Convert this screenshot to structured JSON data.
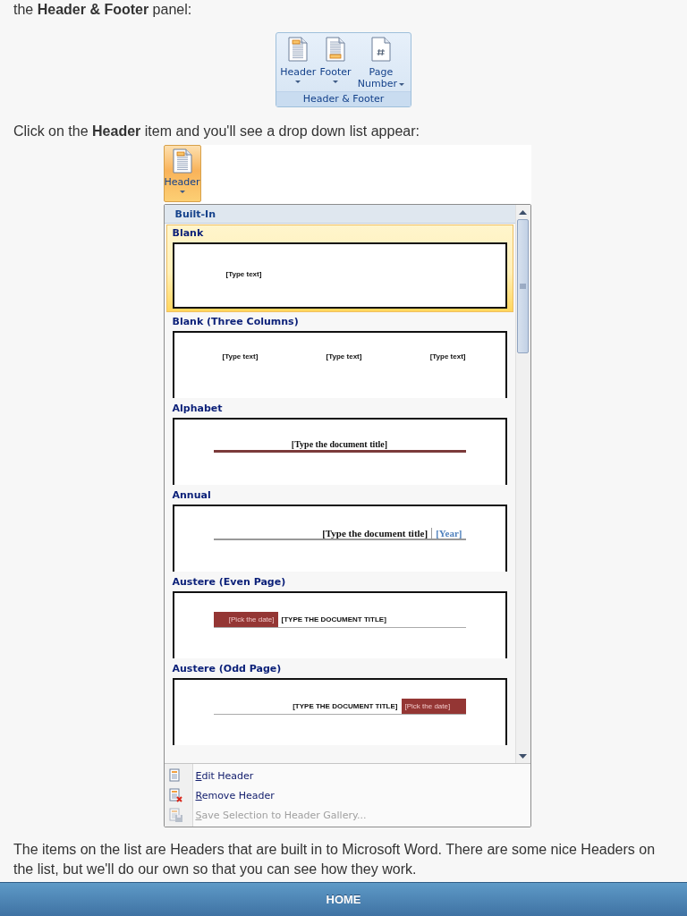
{
  "intro_text": "the **Header & Footer** panel:",
  "ribbon_group": {
    "label": "Header & Footer",
    "buttons": [
      {
        "kind": "header",
        "label": "Header"
      },
      {
        "kind": "footer",
        "label": "Footer"
      },
      {
        "kind": "page-number",
        "label": "Page Number"
      }
    ]
  },
  "instruction_text": "Click on the **Header** item and you'll see a drop down list appear:",
  "active_button": {
    "kind": "header",
    "label": "Header",
    "selected": true
  },
  "gallery": {
    "section": "Built-In",
    "items": [
      {
        "name": "Blank",
        "kind": "blank",
        "selected": true,
        "texts": [
          "[Type text]"
        ]
      },
      {
        "name": "Blank (Three Columns)",
        "kind": "three-columns",
        "selected": false,
        "texts": [
          "[Type text]",
          "[Type text]",
          "[Type text]"
        ]
      },
      {
        "name": "Alphabet",
        "kind": "alphabet",
        "selected": false,
        "texts": [
          "[Type the document title]"
        ]
      },
      {
        "name": "Annual",
        "kind": "annual",
        "selected": false,
        "texts": [
          "[Type the document title]",
          "[Year]"
        ]
      },
      {
        "name": "Austere (Even Page)",
        "kind": "austere-even",
        "selected": false,
        "texts": [
          "[Pick the date]",
          "[TYPE THE DOCUMENT TITLE]"
        ]
      },
      {
        "name": "Austere (Odd Page)",
        "kind": "austere-odd",
        "selected": false,
        "texts": [
          "[TYPE THE DOCUMENT TITLE]",
          "[Pick the date]"
        ]
      }
    ]
  },
  "menu": [
    {
      "kind": "edit",
      "label": "Edit Header",
      "disabled": false
    },
    {
      "kind": "remove",
      "label": "Remove Header",
      "disabled": false
    },
    {
      "kind": "save",
      "label": "Save Selection to Header Gallery...",
      "disabled": true
    }
  ],
  "outro_text": "The items on the list are Headers that are built in to Microsoft Word. There are some nice Headers on the list, but we'll do our own so that you can see how they work.",
  "nav": {
    "label": "HOME"
  }
}
